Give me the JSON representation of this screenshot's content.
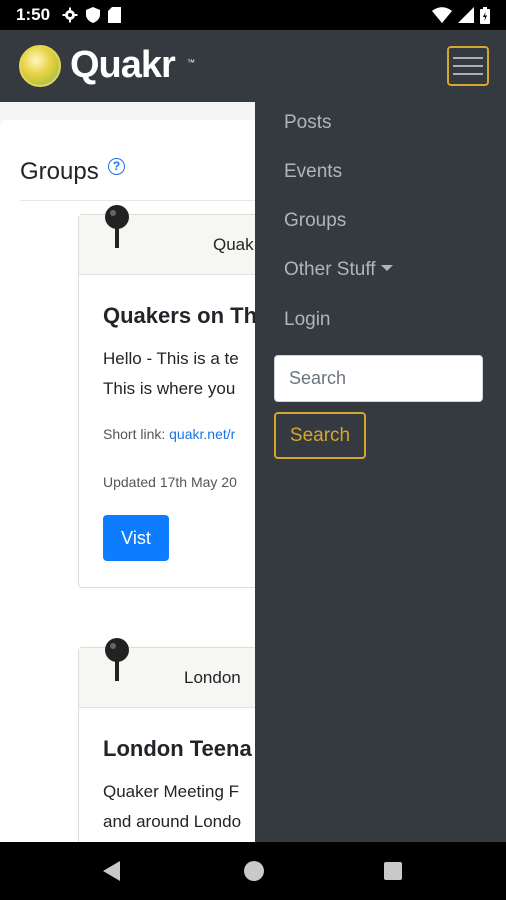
{
  "status_bar": {
    "time": "1:50",
    "icons": [
      "settings-icon",
      "shield-icon",
      "sd-card-icon",
      "wifi-icon",
      "signal-icon",
      "battery-icon"
    ]
  },
  "header": {
    "app_name": "Quakr",
    "tm": "™",
    "menu_icon": "hamburger-menu-icon"
  },
  "page": {
    "title": "Groups",
    "help_icon": "?"
  },
  "groups": [
    {
      "header_text": "Quak",
      "title": "Quakers on Th",
      "text_line1": "Hello - This is a te",
      "text_line2": "This is where you",
      "short_link_label": "Short link: ",
      "short_link": "quakr.net/r",
      "updated": "Updated 17th May 20",
      "button": "Vist"
    },
    {
      "header_text": "London",
      "title": "London Teena",
      "text_line1": "Quaker Meeting F",
      "text_line2": "and around Londo"
    }
  ],
  "drawer": {
    "items": [
      {
        "label": "Posts"
      },
      {
        "label": "Events"
      },
      {
        "label": "Groups"
      },
      {
        "label": "Other Stuff"
      },
      {
        "label": "Login"
      }
    ],
    "search_placeholder": "Search",
    "search_button": "Search"
  },
  "colors": {
    "header_bg": "#343a40",
    "accent": "#d4a72c",
    "primary_button": "#0d7cff",
    "link": "#1a73e8"
  }
}
